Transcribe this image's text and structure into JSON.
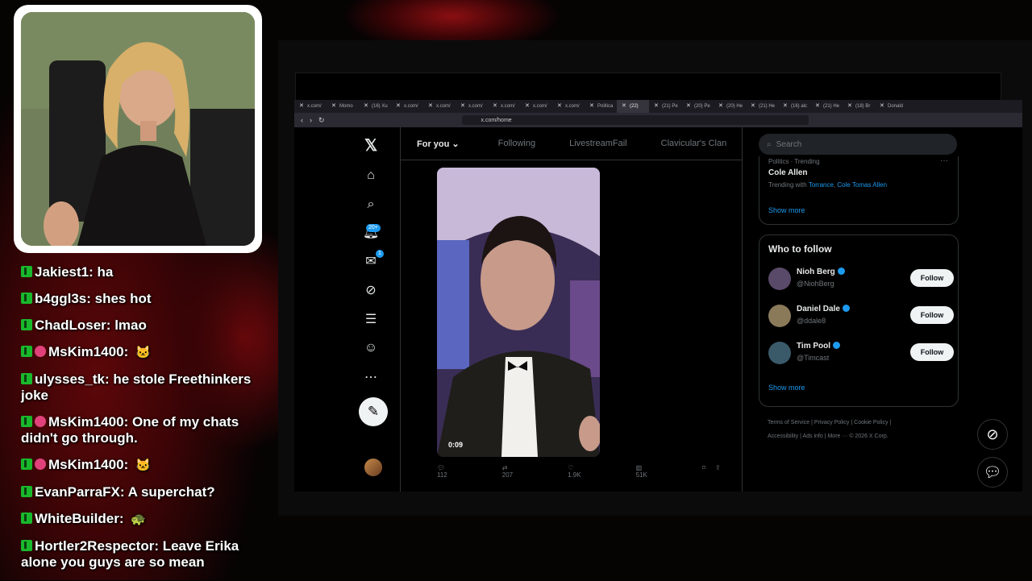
{
  "chat": {
    "messages": [
      {
        "user": "Jakiest1",
        "text": "ha",
        "sub": false,
        "emote": ""
      },
      {
        "user": "b4ggl3s",
        "text": "shes hot",
        "sub": false,
        "emote": ""
      },
      {
        "user": "ChadLoser",
        "text": "lmao",
        "sub": false,
        "emote": ""
      },
      {
        "user": "MsKim1400",
        "text": "",
        "sub": true,
        "emote": "🐱"
      },
      {
        "user": "ulysses_tk",
        "text": "he stole Freethinkers joke",
        "sub": false,
        "emote": ""
      },
      {
        "user": "MsKim1400",
        "text": "One of my chats didn't go through.",
        "sub": true,
        "emote": ""
      },
      {
        "user": "MsKim1400",
        "text": "",
        "sub": true,
        "emote": "🐱"
      },
      {
        "user": "EvanParraFX",
        "text": "A superchat?",
        "sub": false,
        "emote": ""
      },
      {
        "user": "WhiteBuilder",
        "text": "",
        "sub": false,
        "emote": "🐢"
      },
      {
        "user": "Hortler2Respector",
        "text": "Leave Erika alone you guys are so mean",
        "sub": false,
        "emote": ""
      }
    ]
  },
  "browser": {
    "tabs": [
      "x.com/",
      "Momo",
      "(16) Xu",
      "x.com/",
      "x.com/",
      "x.com/",
      "x.com/",
      "x.com/",
      "x.com/",
      "Politica",
      "(22)",
      "(21) Pe",
      "(20) Pe",
      "(20) He",
      "(21) He",
      "(16) alc",
      "(21) He",
      "(18) Br",
      "Donald"
    ],
    "url": "x.com/home"
  },
  "x": {
    "notif_badge": "20+",
    "messages_badge": "1",
    "tabs": {
      "for_you": "For you",
      "following": "Following",
      "t3": "LivestreamFail",
      "t4": "Clavicular's Clan"
    },
    "video": {
      "time": "0:09"
    },
    "actions": {
      "replies": "112",
      "reposts": "207",
      "likes": "1.9K",
      "views": "51K"
    },
    "search_placeholder": "Search",
    "trend": {
      "category": "Politics · Trending",
      "name": "Cole Allen",
      "trending_with_label": "Trending with",
      "with1": "Torrance",
      "with2": "Cole Tomas Allen",
      "show_more": "Show more"
    },
    "who_to_follow": {
      "title": "Who to follow",
      "users": [
        {
          "name": "Nioh Berg",
          "handle": "@NiohBerg",
          "button": "Follow",
          "color": "#5a4a6a"
        },
        {
          "name": "Daniel Dale",
          "handle": "@ddale8",
          "button": "Follow",
          "color": "#8a7a5a"
        },
        {
          "name": "Tim Pool",
          "handle": "@Timcast",
          "button": "Follow",
          "color": "#3a5a6a"
        }
      ],
      "show_more": "Show more"
    },
    "footer": {
      "terms": "Terms of Service",
      "privacy": "Privacy Policy",
      "cookie": "Cookie Policy",
      "accessibility": "Accessibility",
      "ads": "Ads info",
      "more": "More ···",
      "copyright": "© 2026 X Corp."
    }
  }
}
